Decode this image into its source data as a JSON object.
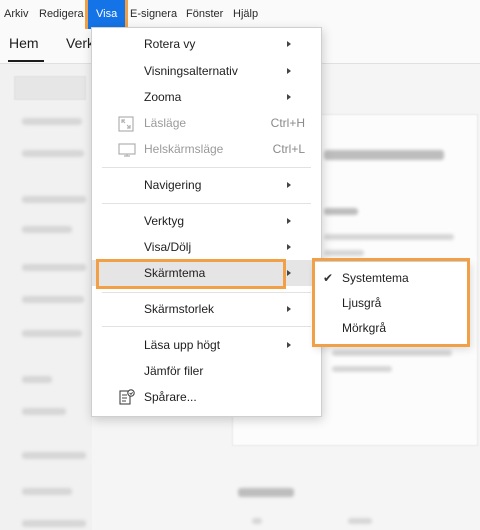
{
  "menubar": {
    "items": [
      "Arkiv",
      "Redigera",
      "Visa",
      "E-signera",
      "Fönster",
      "Hjälp"
    ],
    "active": "Visa"
  },
  "tabs": {
    "home": "Hem",
    "tools_partial": "Verk"
  },
  "view_menu": {
    "items": [
      {
        "label": "Rotera vy",
        "submenu": true
      },
      {
        "label": "Visningsalternativ",
        "submenu": true
      },
      {
        "label": "Zooma",
        "submenu": true
      },
      {
        "label": "Läsläge",
        "shortcut": "Ctrl+H",
        "disabled": true,
        "icon": "reading-mode-icon"
      },
      {
        "label": "Helskärmsläge",
        "shortcut": "Ctrl+L",
        "disabled": true,
        "icon": "fullscreen-icon"
      },
      {
        "label": "Navigering",
        "submenu": true
      },
      {
        "label": "Verktyg",
        "submenu": true
      },
      {
        "label": "Visa/Dölj",
        "submenu": true
      },
      {
        "label": "Skärmtema",
        "submenu": true,
        "highlighted": true
      },
      {
        "label": "Skärmstorlek",
        "submenu": true
      },
      {
        "label": "Läsa upp högt",
        "submenu": true
      },
      {
        "label": "Jämför filer"
      },
      {
        "label": "Spårare...",
        "icon": "tracker-icon"
      }
    ]
  },
  "theme_submenu": {
    "items": [
      {
        "label": "Systemtema",
        "checked": true
      },
      {
        "label": "Ljusgrå",
        "checked": false
      },
      {
        "label": "Mörkgrå",
        "checked": false
      }
    ]
  },
  "background": {
    "heading_partial": "nvändande verktyg",
    "section_partial": "Senaste"
  },
  "colors": {
    "accent": "#1473e6",
    "highlight_outline": "#f2a045",
    "menu_bg": "#ffffff",
    "disabled_text": "#9a9a9a"
  }
}
